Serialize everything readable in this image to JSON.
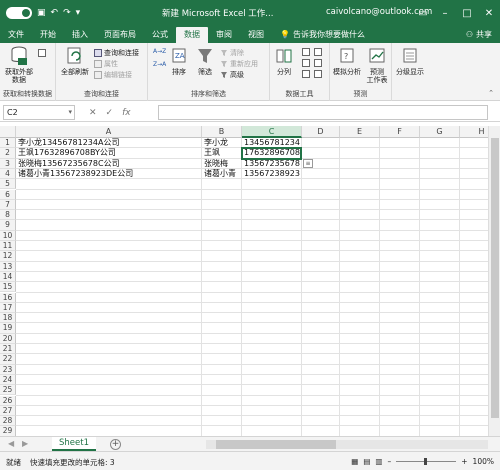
{
  "titlebar": {
    "autosave_icon": "toggle",
    "title": "新建 Microsoft Excel 工作...",
    "user": "caivolcano@outlook.com"
  },
  "tabs": [
    "文件",
    "开始",
    "插入",
    "页面布局",
    "公式",
    "数据",
    "审阅",
    "视图"
  ],
  "active_tab": "数据",
  "tell_me": "告诉我你想要做什么",
  "share": "共享",
  "ribbon": {
    "get_external": "获取外部数据",
    "get_transform_group": "获取和转换数据",
    "refresh_all": "全部刷新",
    "query_connect": "查询和连接",
    "properties": "属性",
    "edit_links": "编辑链接",
    "query_group": "查询和连接",
    "sort_az": "A→Z",
    "sort_za": "Z→A",
    "sort": "排序",
    "filter": "筛选",
    "clear": "清除",
    "reapply": "重新应用",
    "advanced": "高级",
    "sort_filter_group": "排序和筛选",
    "text_to_columns": "分列",
    "data_tools_group": "数据工具",
    "what_if": "模拟分析",
    "forecast_sheet": "预测\n工作表",
    "forecast_group": "预测",
    "outline": "分级显示"
  },
  "formula_bar": {
    "name_box": "C2",
    "cancel": "✕",
    "enter": "✓",
    "fx": "fx",
    "value": ""
  },
  "columns": [
    "A",
    "B",
    "C",
    "D",
    "E",
    "F",
    "G",
    "H"
  ],
  "rows": [
    "1",
    "2",
    "3",
    "4",
    "5",
    "6",
    "7",
    "8",
    "9",
    "10",
    "11",
    "12",
    "13",
    "14",
    "15",
    "16",
    "17",
    "18",
    "19",
    "20",
    "21",
    "22",
    "23",
    "24",
    "25",
    "26",
    "27",
    "28",
    "29"
  ],
  "cells": {
    "A1": "李小龙13456781234A公司",
    "A2": "王飒17632896708BY公司",
    "A3": "张晓梅13567235678C公司",
    "A4": "诸葛小青13567238923DE公司",
    "B1": "李小龙",
    "B2": "王飒",
    "B3": "张晓梅",
    "B4": "诸葛小青",
    "C1": "13456781234",
    "C2": "17632896708",
    "C3": "13567235678",
    "C4": "13567238923"
  },
  "sheet_tab": "Sheet1",
  "status": {
    "ready": "就绪",
    "message": "快速填充更改的单元格: 3",
    "zoom_label": "100%"
  },
  "colors": {
    "accent": "#217346"
  }
}
